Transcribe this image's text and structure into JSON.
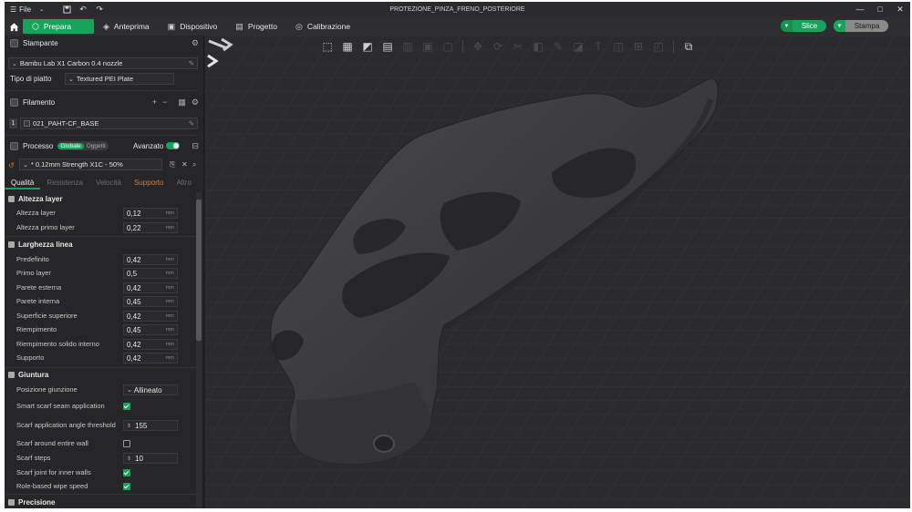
{
  "titlebar": {
    "file_label": "File",
    "title": "PROTEZIONE_PINZA_FRENO_POSTERIORE"
  },
  "toolbar": {
    "tabs": [
      {
        "label": "Prepara",
        "icon": "cube-icon",
        "active": true
      },
      {
        "label": "Anteprima",
        "icon": "layers-icon"
      },
      {
        "label": "Dispositivo",
        "icon": "device-icon"
      },
      {
        "label": "Progetto",
        "icon": "project-icon"
      },
      {
        "label": "Calibrazione",
        "icon": "calibration-icon"
      }
    ],
    "slice_label": "Slice",
    "print_label": "Stampa"
  },
  "printer": {
    "section_label": "Stampante",
    "printer_name": "Bambu Lab X1 Carbon 0.4 nozzle",
    "plate_label": "Tipo di piatto",
    "plate_value": "Textured PEI Plate"
  },
  "filament": {
    "section_label": "Filamento",
    "slot_number": "1",
    "name": "021_PAHT-CF_BASE"
  },
  "process": {
    "section_label": "Processo",
    "badge_global": "Globale",
    "badge_objects": "Oggetti",
    "advanced_label": "Avanzato",
    "preset": "* 0.12mm Strength X1C - 50%"
  },
  "subtabs": [
    "Qualità",
    "Resistenza",
    "Velocità",
    "Supporto",
    "Altro"
  ],
  "groups": {
    "layer_height": "Altezza layer",
    "line_width": "Larghezza linea",
    "seam": "Giuntura",
    "precision": "Precisione"
  },
  "rows": {
    "layer_height": {
      "label": "Altezza layer",
      "value": "0,12",
      "unit": "mm"
    },
    "first_layer_height": {
      "label": "Altezza primo layer",
      "value": "0,22",
      "unit": "mm"
    },
    "default": {
      "label": "Predefinito",
      "value": "0,42",
      "unit": "mm"
    },
    "first_layer": {
      "label": "Primo layer",
      "value": "0,5",
      "unit": "mm"
    },
    "outer_wall": {
      "label": "Parete esterna",
      "value": "0,42",
      "unit": "mm"
    },
    "inner_wall": {
      "label": "Parete interna",
      "value": "0,45",
      "unit": "mm"
    },
    "top_surface": {
      "label": "Superficie superiore",
      "value": "0,42",
      "unit": "mm"
    },
    "infill": {
      "label": "Riempimento",
      "value": "0,45",
      "unit": "mm"
    },
    "internal_solid_infill": {
      "label": "Riempimento solido interno",
      "value": "0,42",
      "unit": "mm"
    },
    "support": {
      "label": "Supporto",
      "value": "0,42",
      "unit": "mm"
    },
    "seam_position": {
      "label": "Posizione giunzione",
      "value": "Allineato"
    },
    "smart_scarf": {
      "label": "Smart scarf seam application",
      "checked": true
    },
    "scarf_angle": {
      "label": "Scarf application angle threshold",
      "value": "155"
    },
    "scarf_entire_wall": {
      "label": "Scarf around entire wall",
      "checked": false
    },
    "scarf_steps": {
      "label": "Scarf steps",
      "value": "10"
    },
    "scarf_inner_walls": {
      "label": "Scarf joint for inner walls",
      "checked": true
    },
    "role_wipe_speed": {
      "label": "Role-based wipe speed",
      "checked": true
    }
  },
  "colors": {
    "accent": "#17a35a",
    "panel": "#262628",
    "viewport": "#2b2b2d",
    "model": "#3b3b3d"
  }
}
